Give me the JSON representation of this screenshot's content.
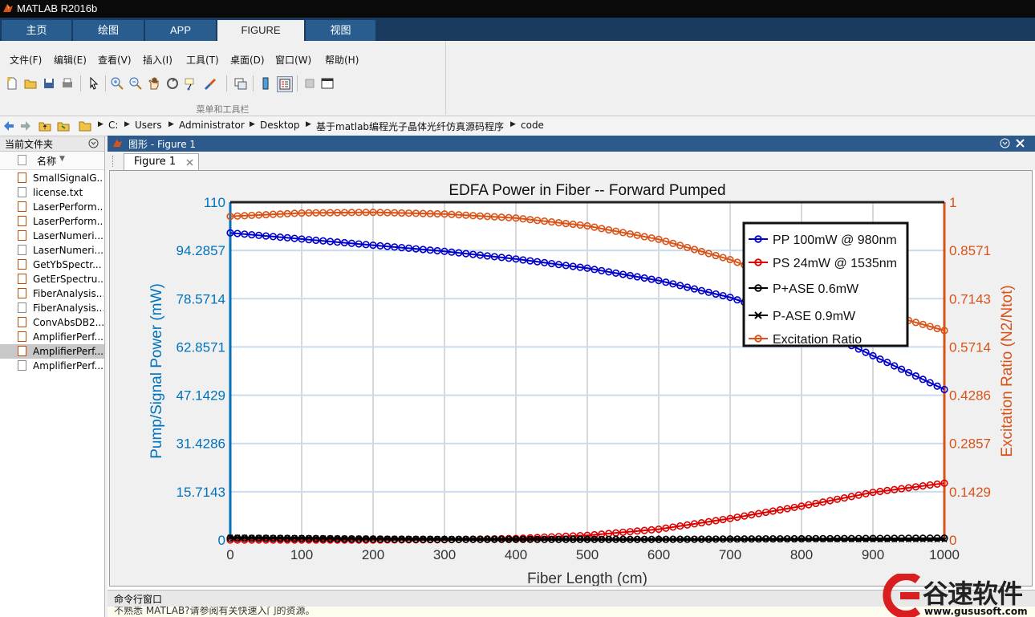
{
  "window": {
    "title": "MATLAB R2016b"
  },
  "ribbon_tabs": [
    "主页",
    "绘图",
    "APP",
    "FIGURE",
    "视图"
  ],
  "active_tab": "FIGURE",
  "menu": [
    "文件(F)",
    "编辑(E)",
    "查看(V)",
    "插入(I)",
    "工具(T)",
    "桌面(D)",
    "窗口(W)",
    "帮助(H)"
  ],
  "toolbar_group_label": "菜单和工具栏",
  "toolbar_icons": [
    "new-file-icon",
    "open-folder-icon",
    "save-icon",
    "print-icon",
    "pointer-icon",
    "zoom-in-icon",
    "zoom-out-icon",
    "pan-icon",
    "rotate-icon",
    "data-cursor-icon",
    "brush-icon",
    "link-icon",
    "colorbar-icon",
    "legend-icon",
    "hide-tools-icon",
    "dock-icon"
  ],
  "address": {
    "crumbs": [
      "C:",
      "Users",
      "Administrator",
      "Desktop",
      "基于matlab编程光子晶体光纤仿真源码程序",
      "code"
    ]
  },
  "file_browser": {
    "title": "当前文件夹",
    "column": "名称",
    "files": [
      {
        "name": "SmallSignalG...",
        "type": "m"
      },
      {
        "name": "license.txt",
        "type": "txt"
      },
      {
        "name": "LaserPerform...",
        "type": "m"
      },
      {
        "name": "LaserPerform...",
        "type": "m"
      },
      {
        "name": "LaserNumeri...",
        "type": "m"
      },
      {
        "name": "LaserNumeri...",
        "type": "txt"
      },
      {
        "name": "GetYbSpectr...",
        "type": "m"
      },
      {
        "name": "GetErSpectru...",
        "type": "m"
      },
      {
        "name": "FiberAnalysis....",
        "type": "m"
      },
      {
        "name": "FiberAnalysis....",
        "type": "txt"
      },
      {
        "name": "ConvAbsDB2...",
        "type": "m"
      },
      {
        "name": "AmplifierPerf...",
        "type": "m"
      },
      {
        "name": "AmplifierPerf...",
        "type": "m",
        "selected": true
      },
      {
        "name": "AmplifierPerf...",
        "type": "txt"
      }
    ]
  },
  "figure_window": {
    "title": "图形 - Figure 1",
    "tab": "Figure 1"
  },
  "command_window": {
    "title": "命令行窗口",
    "text": "不熟悉 MATLAB?请参阅有关快速入门的资源。"
  },
  "watermark": {
    "brand": "谷速软件",
    "url": "www.gususoft.com"
  },
  "colors": {
    "pump": "#0000cc",
    "signal": "#dd0000",
    "ase": "#000000",
    "excitation": "#d95319",
    "left_axis": "#0072bd",
    "ribbon_dark": "#1b3a60",
    "figure_title": "#2c5a8c"
  },
  "chart_data": {
    "type": "line",
    "title": "EDFA Power in Fiber -- Forward Pumped",
    "xlabel": "Fiber Length (cm)",
    "ylabel": "Pump/Signal Power (mW)",
    "ylabel_right": "Excitation Ratio (N2/Ntot)",
    "xlim": [
      0,
      1000
    ],
    "ylim": [
      0,
      110
    ],
    "ylim_right": [
      0,
      1
    ],
    "xticks": [
      0,
      100,
      200,
      300,
      400,
      500,
      600,
      700,
      800,
      900,
      1000
    ],
    "yticks": [
      "0",
      "15.7143",
      "31.4286",
      "47.1429",
      "62.8571",
      "78.5714",
      "94.2857",
      "110"
    ],
    "yticks_right": [
      "0",
      "0.1429",
      "0.2857",
      "0.4286",
      "0.5714",
      "0.7143",
      "0.8571",
      "1"
    ],
    "grid": true,
    "legend_position": "top-right",
    "x": [
      0,
      100,
      200,
      300,
      400,
      500,
      600,
      700,
      800,
      900,
      1000
    ],
    "series": [
      {
        "name": "PP 100mW @ 980nm",
        "axis": "left",
        "color": "#0000cc",
        "marker": "o",
        "values": [
          100,
          98,
          96,
          94,
          91.5,
          88.5,
          84.5,
          79,
          71,
          60,
          49
        ]
      },
      {
        "name": "PS 24mW @ 1535nm",
        "axis": "left",
        "color": "#dd0000",
        "marker": "o",
        "values": [
          0,
          0,
          0,
          0.1,
          0.5,
          1.5,
          3.5,
          7,
          11,
          15.5,
          18.5
        ]
      },
      {
        "name": "P+ASE 0.6mW",
        "axis": "left",
        "color": "#000000",
        "marker": "o",
        "values": [
          0.6,
          0.5,
          0.3,
          0.2,
          0.2,
          0.2,
          0.2,
          0.3,
          0.4,
          0.5,
          0.6
        ]
      },
      {
        "name": "P-ASE 0.9mW",
        "axis": "left",
        "color": "#000000",
        "marker": "x",
        "values": [
          0.9,
          0.7,
          0.5,
          0.4,
          0.3,
          0.2,
          0.2,
          0.2,
          0.2,
          0.1,
          0.1
        ]
      },
      {
        "name": "Excitation Ratio",
        "axis": "right",
        "color": "#d95319",
        "marker": "o",
        "values": [
          0.958,
          0.968,
          0.97,
          0.965,
          0.953,
          0.93,
          0.89,
          0.83,
          0.75,
          0.68,
          0.62
        ]
      }
    ]
  }
}
